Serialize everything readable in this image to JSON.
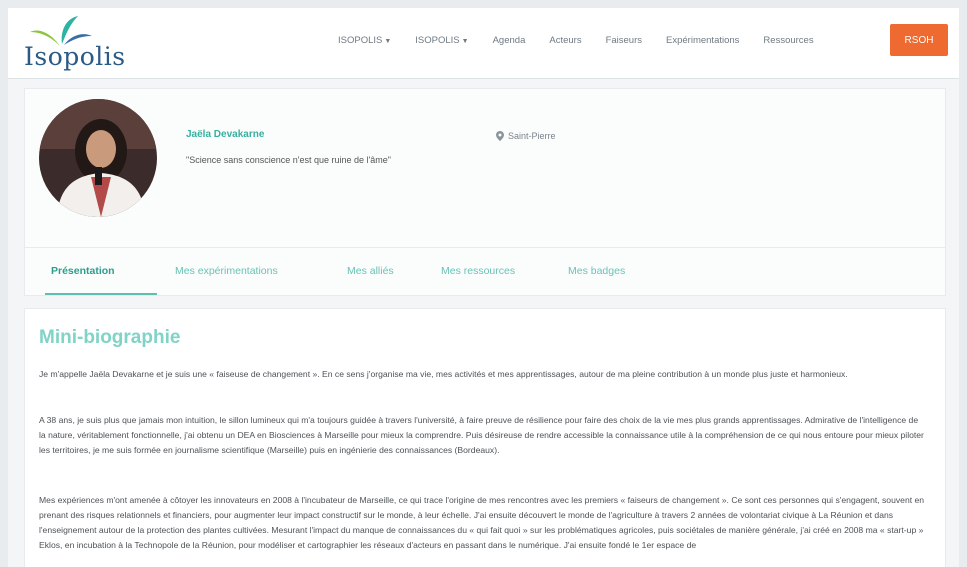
{
  "brand": {
    "name": "Isopolis",
    "colors": {
      "teal": "#36b0a0",
      "orange": "#ee6a30",
      "navy": "#2a5a86",
      "green": "#8cc63f"
    }
  },
  "nav": {
    "items": [
      {
        "label": "ISOPOLIS",
        "dropdown": true
      },
      {
        "label": "ISOPOLIS",
        "dropdown": true
      },
      {
        "label": "Agenda"
      },
      {
        "label": "Acteurs"
      },
      {
        "label": "Faiseurs"
      },
      {
        "label": "Expérimentations"
      },
      {
        "label": "Ressources"
      }
    ],
    "cta_label": "RSOH"
  },
  "profile": {
    "name": "Jaëla Devakarne",
    "quote": "\"Science sans conscience n'est que ruine de l'âme\"",
    "location": "Saint-Pierre"
  },
  "tabs": [
    {
      "label": "Présentation",
      "active": true
    },
    {
      "label": "Mes expérimentations"
    },
    {
      "label": "Mes alliés"
    },
    {
      "label": "Mes ressources"
    },
    {
      "label": "Mes badges"
    }
  ],
  "content": {
    "heading": "Mini-biographie",
    "p1": "Je m'appelle Jaëla Devakarne et je suis une « faiseuse de changement ». En ce sens j'organise ma vie, mes activités et mes apprentissages, autour de ma pleine contribution à un monde plus juste et harmonieux.",
    "p2": "A 38 ans, je suis plus que jamais mon intuition, le sillon lumineux qui m'a toujours guidée à travers l'université, à faire preuve de résilience pour faire des choix de la vie mes plus grands apprentissages. Admirative de l'intelligence de la nature, véritablement fonctionnelle, j'ai obtenu un DEA en Biosciences à Marseille pour mieux la comprendre. Puis désireuse de rendre accessible la connaissance utile à la compréhension de ce qui nous entoure pour mieux piloter les territoires, je me suis formée en journalisme scientifique (Marseille) puis en ingénierie des connaissances (Bordeaux).",
    "p3": "Mes expériences m'ont amenée à côtoyer les innovateurs en 2008 à l'incubateur de Marseille, ce qui trace l'origine de mes rencontres avec les premiers « faiseurs de changement ». Ce sont ces personnes qui s'engagent, souvent en prenant des risques relationnels et financiers, pour augmenter leur impact constructif sur le monde, à leur échelle. J'ai ensuite découvert le monde de l'agriculture à travers 2 années de volontariat civique à La Réunion et dans l'enseignement autour de la protection des plantes cultivées. Mesurant l'impact du manque de connaissances du « qui fait quoi » sur les problématiques agricoles, puis sociétales de manière générale, j'ai créé en 2008 ma « start-up » Eklos, en incubation à la Technopole de la Réunion, pour modéliser et cartographier les réseaux d'acteurs en passant dans le numérique. J'ai ensuite fondé le 1er espace de"
  }
}
